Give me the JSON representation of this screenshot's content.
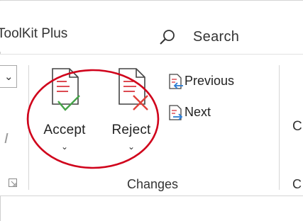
{
  "header": {
    "app_tab_label": "ToolKit Plus",
    "search_label": "Search"
  },
  "ribbon": {
    "accept_label": "Accept",
    "reject_label": "Reject",
    "previous_label": "Previous",
    "next_label": "Next",
    "group_label": "Changes",
    "partial_next_group_initial": "C",
    "partial_next_group_label_initial": "C"
  },
  "colors": {
    "highlight_ring": "#d0021b",
    "accept_check": "#45a348",
    "reject_x": "#e0413a",
    "doc_lines": "#d9363e",
    "nav_arrow": "#2b7cd3"
  },
  "icons": {
    "search": "search-icon",
    "accept": "accept-change-icon",
    "reject": "reject-change-icon",
    "previous": "previous-change-icon",
    "next": "next-change-icon",
    "launcher": "dialog-launcher-icon",
    "dropdown": "chevron-down-icon"
  }
}
